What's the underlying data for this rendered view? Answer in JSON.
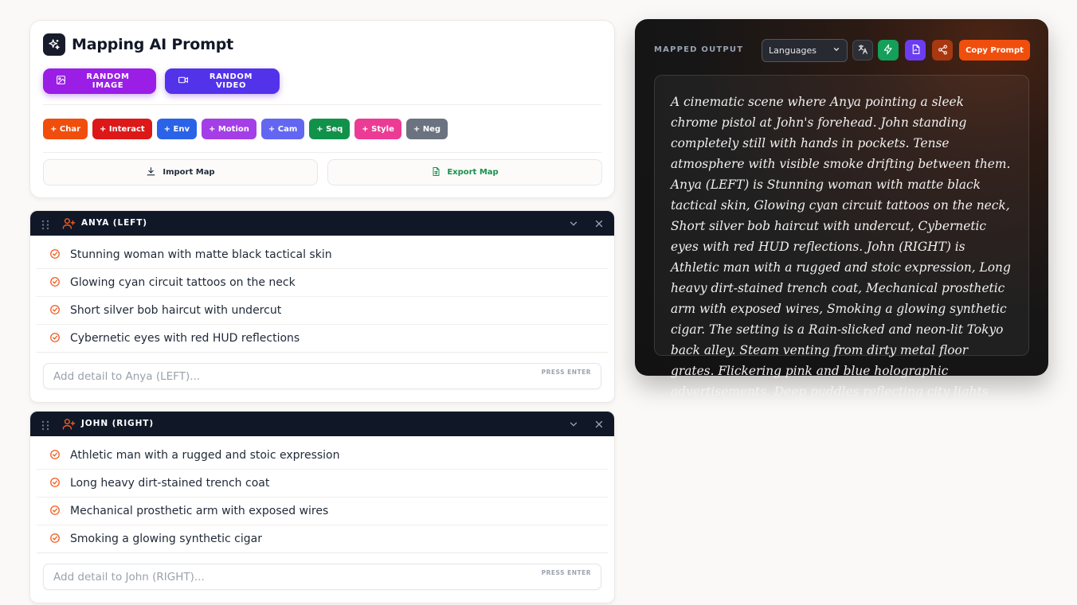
{
  "app": {
    "title": "Mapping AI Prompt"
  },
  "random_buttons": {
    "image": "RANDOM IMAGE",
    "video": "RANDOM VIDEO"
  },
  "chips": [
    {
      "label": "+ Char",
      "color": "#f04e0d"
    },
    {
      "label": "+ Interact",
      "color": "#dc1818"
    },
    {
      "label": "+ Env",
      "color": "#2a63e8"
    },
    {
      "label": "+ Motion",
      "color": "#a43ee6"
    },
    {
      "label": "+ Cam",
      "color": "#6366f1"
    },
    {
      "label": "+ Seq",
      "color": "#11914a"
    },
    {
      "label": "+ Style",
      "color": "#ec3b95"
    },
    {
      "label": "+ Neg",
      "color": "#6b7280"
    }
  ],
  "io": {
    "import_label": "Import Map",
    "export_label": "Export Map"
  },
  "characters": [
    {
      "name": "ANYA (LEFT)",
      "details": [
        "Stunning woman with matte black tactical skin",
        "Glowing cyan circuit tattoos on the neck",
        "Short silver bob haircut with undercut",
        "Cybernetic eyes with red HUD reflections"
      ],
      "input_placeholder": "Add detail to Anya (LEFT)...",
      "hint": "PRESS ENTER"
    },
    {
      "name": "JOHN (RIGHT)",
      "details": [
        "Athletic man with a rugged and stoic expression",
        "Long heavy dirt-stained trench coat",
        "Mechanical prosthetic arm with exposed wires",
        "Smoking a glowing synthetic cigar"
      ],
      "input_placeholder": "Add detail to John (RIGHT)...",
      "hint": "PRESS ENTER"
    }
  ],
  "output": {
    "label": "MAPPED OUTPUT",
    "language_selected": "Languages",
    "copy_label": "Copy Prompt",
    "text": "A cinematic scene where Anya pointing a sleek chrome pistol at John's forehead. John standing completely still with hands in pockets. Tense atmosphere with visible smoke drifting between them. Anya (LEFT) is Stunning woman with matte black tactical skin, Glowing cyan circuit tattoos on the neck, Short silver bob haircut with undercut, Cybernetic eyes with red HUD reflections. John (RIGHT) is Athletic man with a rugged and stoic expression, Long heavy dirt-stained trench coat, Mechanical prosthetic arm with exposed wires, Smoking a glowing synthetic cigar. The setting is a Rain-slicked and neon-lit Tokyo back alley. Steam venting from dirty metal floor grates. Flickering pink and blue holographic advertisements. Deep puddles reflecting city lights"
  },
  "colors": {
    "accent_orange": "#f04e0d",
    "header_dark": "#101828"
  },
  "icons": {
    "logo": "sparkles-icon",
    "image": "image-icon",
    "video": "video-camera-icon",
    "import": "download-icon",
    "export": "spreadsheet-file-icon",
    "drag": "grip-vertical-icon",
    "person": "user-plus-icon",
    "collapse": "chevron-down-icon",
    "close": "close-icon",
    "item": "check-circle-icon",
    "translate": "translate-icon",
    "flash": "lightning-icon",
    "pdf": "pdf-file-icon",
    "share": "share-icon"
  }
}
